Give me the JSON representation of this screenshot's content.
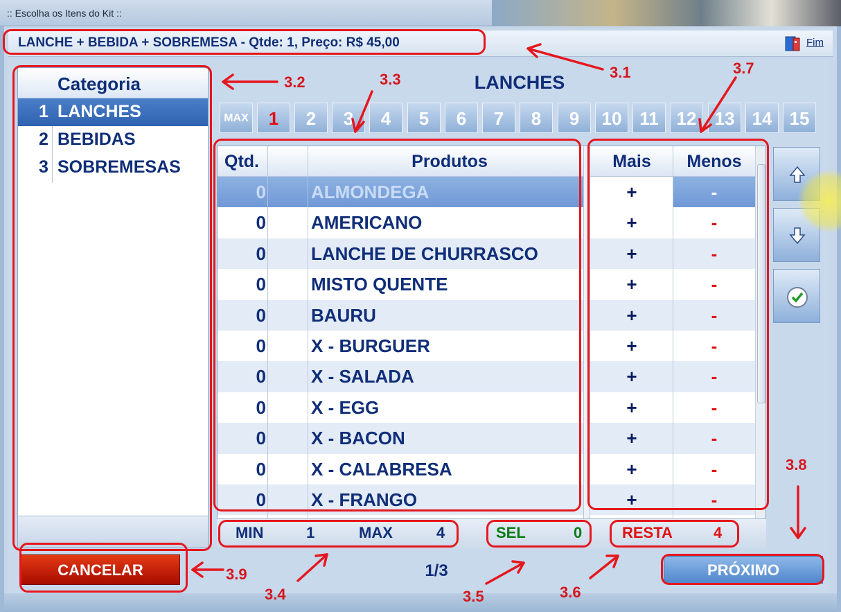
{
  "window": {
    "title": ":: Escolha os Itens do Kit ::"
  },
  "kit_info": "LANCHE + BEBIDA + SOBREMESA - Qtde:  1, Preço: R$ 45,00",
  "fim_label": "Fim",
  "categories": {
    "header": "Categoria",
    "items": [
      {
        "num": "1",
        "label": "LANCHES",
        "selected": true
      },
      {
        "num": "2",
        "label": "BEBIDAS",
        "selected": false
      },
      {
        "num": "3",
        "label": "SOBREMESAS",
        "selected": false
      }
    ]
  },
  "current_category": "LANCHES",
  "qty_buttons": {
    "max_label": "MAX",
    "current": "1",
    "numbers": [
      "1",
      "2",
      "3",
      "4",
      "5",
      "6",
      "7",
      "8",
      "9",
      "10",
      "11",
      "12",
      "13",
      "14",
      "15"
    ]
  },
  "grid": {
    "columns": {
      "qty": "Qtd.",
      "product": "Produtos",
      "plus": "Mais",
      "minus": "Menos"
    },
    "plus_symbol": "+",
    "minus_symbol": "-",
    "rows": [
      {
        "qty": "0",
        "product": "ALMONDEGA"
      },
      {
        "qty": "0",
        "product": "AMERICANO"
      },
      {
        "qty": "0",
        "product": "LANCHE DE CHURRASCO"
      },
      {
        "qty": "0",
        "product": "MISTO QUENTE"
      },
      {
        "qty": "0",
        "product": "BAURU"
      },
      {
        "qty": "0",
        "product": "X - BURGUER"
      },
      {
        "qty": "0",
        "product": "X - SALADA"
      },
      {
        "qty": "0",
        "product": "X - EGG"
      },
      {
        "qty": "0",
        "product": "X - BACON"
      },
      {
        "qty": "0",
        "product": "X - CALABRESA"
      },
      {
        "qty": "0",
        "product": "X - FRANGO"
      }
    ]
  },
  "stats": {
    "min_label": "MIN",
    "min_value": "1",
    "max_label": "MAX",
    "max_value": "4",
    "sel_label": "SEL",
    "sel_value": "0",
    "resta_label": "RESTA",
    "resta_value": "4"
  },
  "footer": {
    "cancel_label": "CANCELAR",
    "page": "1/3",
    "next_label": "PRÓXIMO"
  },
  "annotations": {
    "a3_1": "3.1",
    "a3_2": "3.2",
    "a3_3": "3.3",
    "a3_4": "3.4",
    "a3_5": "3.5",
    "a3_6": "3.6",
    "a3_7": "3.7",
    "a3_8": "3.8",
    "a3_9": "3.9"
  },
  "colors": {
    "accent_red": "#e01010",
    "text_blue": "#102e78",
    "annotation": "#d4171c",
    "green": "#0a7a14"
  }
}
